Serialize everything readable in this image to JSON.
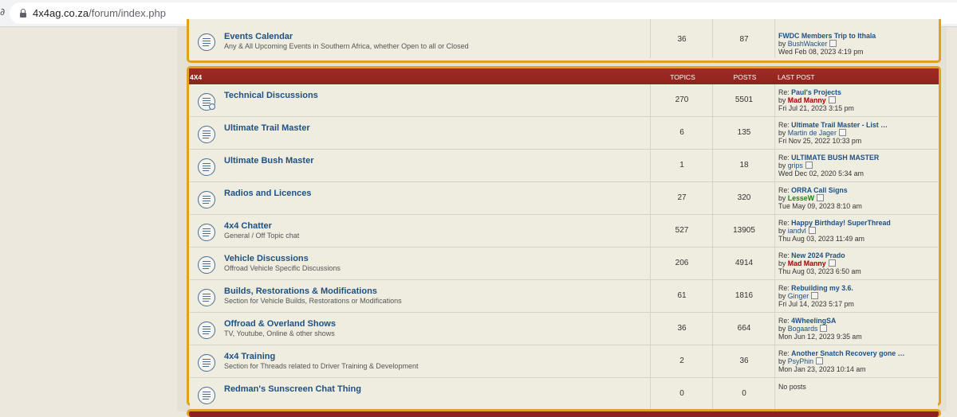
{
  "browser": {
    "edge_glyph": "∂",
    "url_host": "4x4ag.co.za",
    "url_path": "/forum/index.php"
  },
  "top_block": {
    "row": {
      "title": "Events Calendar",
      "desc": "Any & All Upcoming Events in Southern Africa, whether Open to all or Closed",
      "topics": "36",
      "posts": "87",
      "last_title": "FWDC Members Trip to Ithala",
      "last_by": "by",
      "last_user": "BushWacker",
      "last_date": "Wed Feb 08, 2023 4:19 pm"
    }
  },
  "category": {
    "title": "4X4",
    "col_topics": "TOPICS",
    "col_posts": "POSTS",
    "col_last": "LAST POST",
    "rows": [
      {
        "title": "Technical Discussions",
        "desc": "",
        "topics": "270",
        "posts": "5501",
        "re": "Re:",
        "last_title": "Paul's Projects",
        "by": "by",
        "user": "Mad Manny",
        "date": "Fri Jul 21, 2023 3:15 pm"
      },
      {
        "title": "Ultimate Trail Master",
        "desc": "",
        "topics": "6",
        "posts": "135",
        "re": "Re:",
        "last_title": "Ultimate Trail Master - List …",
        "by": "by",
        "user": "Martin de Jager",
        "date": "Fri Nov 25, 2022 10:33 pm"
      },
      {
        "title": "Ultimate Bush Master",
        "desc": "",
        "topics": "1",
        "posts": "18",
        "re": "Re:",
        "last_title": "ULTIMATE BUSH MASTER",
        "by": "by",
        "user": "grips",
        "date": "Wed Dec 02, 2020 5:34 am"
      },
      {
        "title": "Radios and Licences",
        "desc": "",
        "topics": "27",
        "posts": "320",
        "re": "Re:",
        "last_title": "ORRA Call Signs",
        "by": "by",
        "user": "LesseW",
        "date": "Tue May 09, 2023 8:10 am"
      },
      {
        "title": "4x4 Chatter",
        "desc": "General / Off Topic chat",
        "topics": "527",
        "posts": "13905",
        "re": "Re:",
        "last_title": "Happy Birthday! SuperThread",
        "by": "by",
        "user": "iandvl",
        "date": "Thu Aug 03, 2023 11:49 am"
      },
      {
        "title": "Vehicle Discussions",
        "desc": "Offroad Vehicle Specific Discussions",
        "topics": "206",
        "posts": "4914",
        "re": "Re:",
        "last_title": "New 2024 Prado",
        "by": "by",
        "user": "Mad Manny",
        "date": "Thu Aug 03, 2023 6:50 am"
      },
      {
        "title": "Builds, Restorations & Modifications",
        "desc": "Section for Vehicle Builds, Restorations or Modifications",
        "topics": "61",
        "posts": "1816",
        "re": "Re:",
        "last_title": "Rebuilding my 3.6.",
        "by": "by",
        "user": "Ginger",
        "date": "Fri Jul 14, 2023 5:17 pm"
      },
      {
        "title": "Offroad & Overland Shows",
        "desc": "TV, Youtube, Online & other shows",
        "topics": "36",
        "posts": "664",
        "re": "Re:",
        "last_title": "4WheelingSA",
        "by": "by",
        "user": "Bogaards",
        "date": "Mon Jun 12, 2023 9:35 am"
      },
      {
        "title": "4x4 Training",
        "desc": "Section for Threads related to Driver Training & Development",
        "topics": "2",
        "posts": "36",
        "re": "Re:",
        "last_title": "Another Snatch Recovery gone …",
        "by": "by",
        "user": "PsyPhin",
        "date": "Mon Jan 23, 2023 10:14 am"
      },
      {
        "title": "Redman's Sunscreen Chat Thing",
        "desc": "",
        "topics": "0",
        "posts": "0",
        "no_posts": "No posts"
      }
    ]
  }
}
